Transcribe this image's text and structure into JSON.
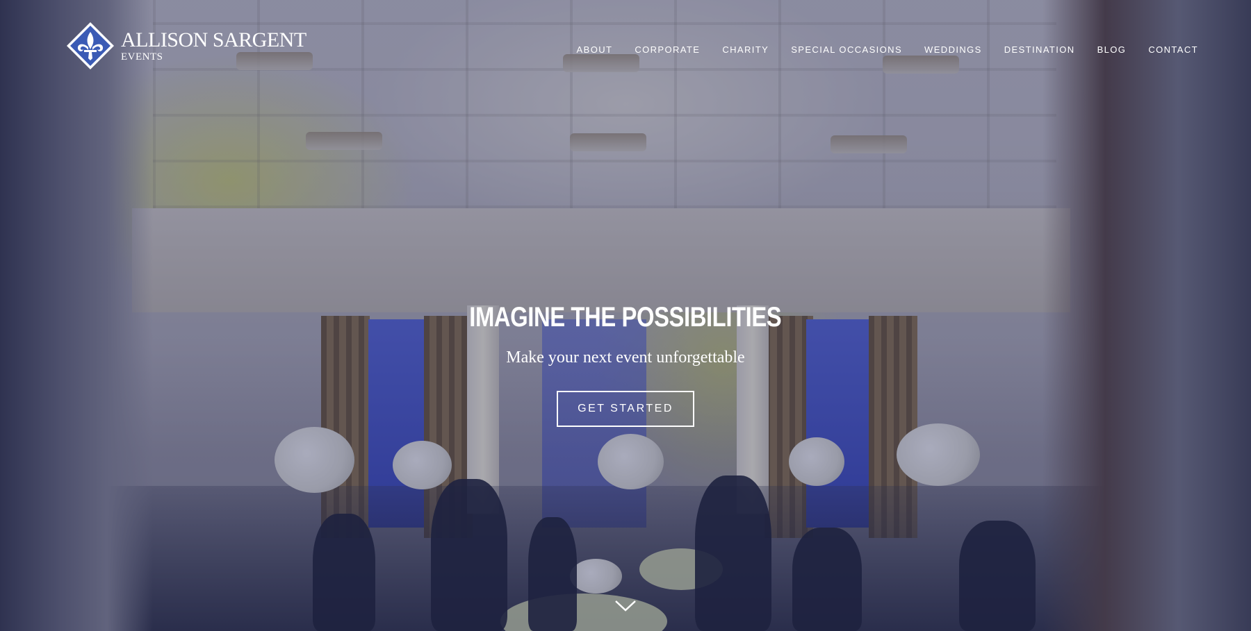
{
  "brand": {
    "name": "ALLISON SARGENT",
    "subtitle": "EVENTS",
    "logo_icon": "fleur-de-lis-icon",
    "logo_color": "#3b5bb5"
  },
  "nav": {
    "items": [
      {
        "label": "ABOUT"
      },
      {
        "label": "CORPORATE"
      },
      {
        "label": "CHARITY"
      },
      {
        "label": "SPECIAL OCCASIONS"
      },
      {
        "label": "WEDDINGS"
      },
      {
        "label": "DESTINATION"
      },
      {
        "label": "BLOG"
      },
      {
        "label": "CONTACT"
      }
    ]
  },
  "hero": {
    "title": "IMAGINE THE POSSIBILITIES",
    "subtitle": "Make your next event unforgettable",
    "cta_label": "GET STARTED",
    "scroll_icon": "chevron-down-icon"
  }
}
